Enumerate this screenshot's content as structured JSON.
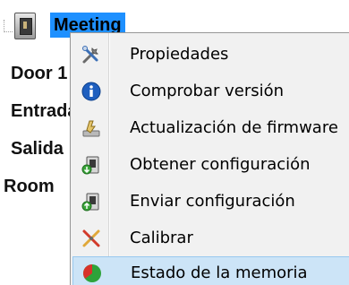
{
  "tree": {
    "root": {
      "label": "Meeting",
      "icon": "access-reader-icon"
    },
    "children": [
      "Door 1",
      "Entrada",
      "Salida",
      "Room"
    ]
  },
  "context_menu": {
    "items": [
      {
        "label": "Propiedades",
        "icon": "tools-icon"
      },
      {
        "label": "Comprobar versión",
        "icon": "info-icon"
      },
      {
        "label": "Actualización de firmware",
        "icon": "firmware-update-icon"
      },
      {
        "label": "Obtener configuración",
        "icon": "get-config-icon"
      },
      {
        "label": "Enviar configuración",
        "icon": "send-config-icon"
      },
      {
        "label": "Calibrar",
        "icon": "calibrate-icon"
      },
      {
        "label": "Estado de la memoria",
        "icon": "memory-status-icon",
        "highlighted": true
      }
    ]
  },
  "colors": {
    "selection": "#1e90ff",
    "menu_background": "#f1f1f1",
    "menu_highlight": "#cce4f7"
  }
}
